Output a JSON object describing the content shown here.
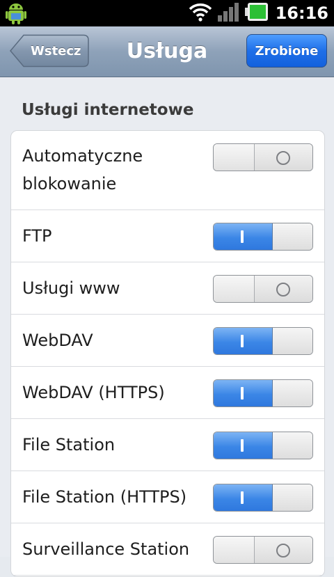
{
  "status_bar": {
    "time": "16:16",
    "icons": [
      "android-icon",
      "wifi-icon",
      "signal-icon",
      "battery-icon"
    ]
  },
  "nav": {
    "back_label": "Wstecz",
    "title": "Usługa",
    "done_label": "Zrobione",
    "colors": {
      "bar": "#8ea2b9",
      "done": "#1f6fe8"
    }
  },
  "section": {
    "title": "Usługi internetowe"
  },
  "services": [
    {
      "label_line1": "Automatyczne",
      "label_line2": "blokowanie",
      "enabled": false
    },
    {
      "label": "FTP",
      "enabled": true
    },
    {
      "label": "Usługi www",
      "enabled": false
    },
    {
      "label": "WebDAV",
      "enabled": true
    },
    {
      "label": "WebDAV (HTTPS)",
      "enabled": true
    },
    {
      "label": "File Station",
      "enabled": true
    },
    {
      "label": "File Station (HTTPS)",
      "enabled": true
    },
    {
      "label": "Surveillance Station",
      "enabled": false
    }
  ],
  "toggle_colors": {
    "on": "#3b86e6",
    "off": "#e2e2e2"
  }
}
